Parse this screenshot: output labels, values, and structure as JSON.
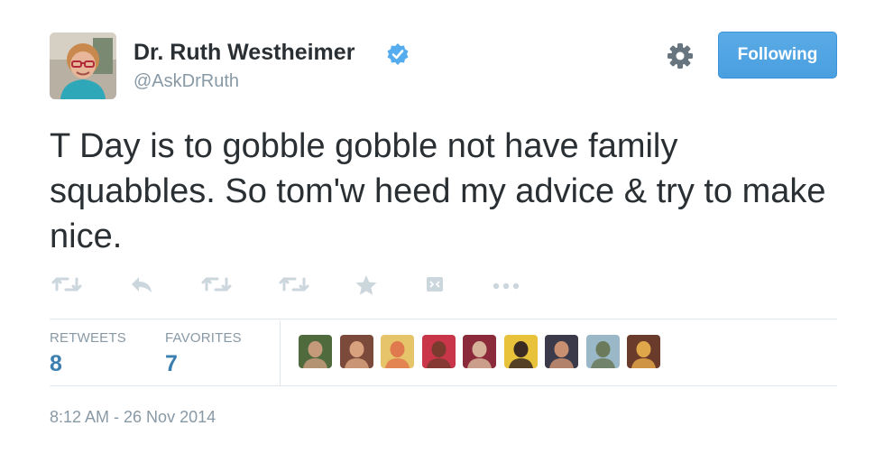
{
  "header": {
    "display_name": "Dr. Ruth Westheimer",
    "handle": "@AskDrRuth",
    "follow_label": "Following"
  },
  "tweet": {
    "text": "T Day is to gobble gobble not have family squabbles. So tom'w heed my advice & try to make nice."
  },
  "actions": [
    {
      "icon": "retweet-icon"
    },
    {
      "icon": "reply-icon"
    },
    {
      "icon": "retweet-icon"
    },
    {
      "icon": "retweet-icon"
    },
    {
      "icon": "star-icon"
    },
    {
      "icon": "embed-icon"
    },
    {
      "icon": "more-icon"
    }
  ],
  "stats": {
    "retweets_label": "RETWEETS",
    "retweets_value": "8",
    "favorites_label": "FAVORITES",
    "favorites_value": "7"
  },
  "favoriters": [
    {
      "icon": "user-avatar",
      "bg": "#4f6b3e",
      "skin": "#c49a7a"
    },
    {
      "icon": "user-avatar",
      "bg": "#7c4a3a",
      "skin": "#d8a27f"
    },
    {
      "icon": "user-avatar",
      "bg": "#e6c46a",
      "skin": "#e07a4e"
    },
    {
      "icon": "user-avatar",
      "bg": "#c9364a",
      "skin": "#7a3a2e"
    },
    {
      "icon": "user-avatar",
      "bg": "#8a2a3a",
      "skin": "#d6b29a"
    },
    {
      "icon": "user-avatar",
      "bg": "#e8c23a",
      "skin": "#3a2a22"
    },
    {
      "icon": "user-avatar",
      "bg": "#3a3a4a",
      "skin": "#c89070"
    },
    {
      "icon": "user-avatar",
      "bg": "#9ab8c8",
      "skin": "#6a7a5a"
    },
    {
      "icon": "user-avatar",
      "bg": "#6a3a2a",
      "skin": "#e0a64a"
    }
  ],
  "timestamp": "8:12 AM - 26 Nov 2014",
  "colors": {
    "accent": "#4a9fe0",
    "verified": "#55acee",
    "muted": "#8899a6",
    "stat_value": "#3a7fb0",
    "text": "#292f33"
  }
}
